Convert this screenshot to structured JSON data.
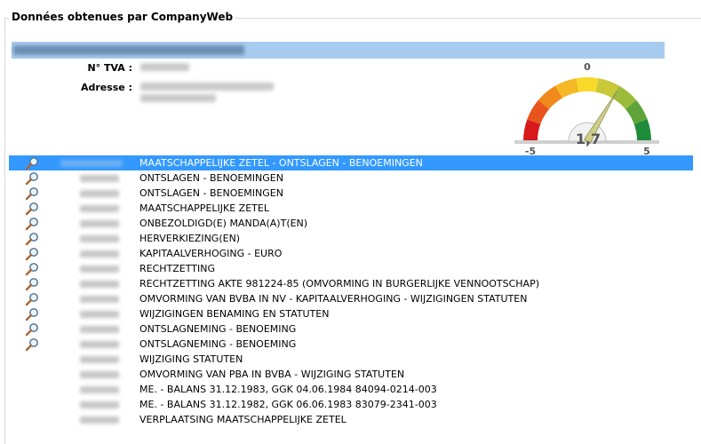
{
  "legend": "Données obtenues par CompanyWeb",
  "info": {
    "tva_label": "N° TVA :",
    "address_label": "Adresse :"
  },
  "gauge": {
    "value": "1,7",
    "value_numeric": 1.7,
    "min_label": "-5",
    "mid_label": "0",
    "max_label": "5",
    "colors": [
      "#d7191c",
      "#e8541b",
      "#f08a1d",
      "#f6b724",
      "#f8d92a",
      "#c8c838",
      "#9dbb3a",
      "#5ea43a",
      "#1e8c3a"
    ]
  },
  "rows": [
    {
      "text": "MAATSCHAPPELIJKE ZETEL - ONTSLAGEN - BENOEMINGEN",
      "icon": true,
      "selected": true
    },
    {
      "text": "ONTSLAGEN - BENOEMINGEN",
      "icon": true
    },
    {
      "text": "ONTSLAGEN - BENOEMINGEN",
      "icon": true
    },
    {
      "text": "MAATSCHAPPELIJKE ZETEL",
      "icon": true
    },
    {
      "text": "ONBEZOLDIGD(E) MANDA(A)T(EN)",
      "icon": true
    },
    {
      "text": "HERVERKIEZING(EN)",
      "icon": true
    },
    {
      "text": "KAPITAALVERHOGING - EURO",
      "icon": true
    },
    {
      "text": "RECHTZETTING",
      "icon": true
    },
    {
      "text": "RECHTZETTING AKTE 981224-85 (OMVORMING IN BURGERLIJKE VENNOOTSCHAP)",
      "icon": true
    },
    {
      "text": "OMVORMING VAN BVBA IN NV - KAPITAALVERHOGING - WIJZIGINGEN STATUTEN",
      "icon": true
    },
    {
      "text": "WIJZIGINGEN BENAMING EN STATUTEN",
      "icon": true
    },
    {
      "text": "ONTSLAGNEMING - BENOEMING",
      "icon": true
    },
    {
      "text": "ONTSLAGNEMING - BENOEMING",
      "icon": true
    },
    {
      "text": "WIJZIGING STATUTEN",
      "icon": false
    },
    {
      "text": "OMVORMING VAN PBA IN BVBA - WIJZIGING STATUTEN",
      "icon": false
    },
    {
      "text": "ME. - BALANS 31.12.1983, GGK 04.06.1984 84094-0214-003",
      "icon": false
    },
    {
      "text": "ME. - BALANS 31.12.1982, GGK 06.06.1983 83079-2341-003",
      "icon": false
    },
    {
      "text": "VERPLAATSING MAATSCHAPPELIJKE ZETEL",
      "icon": false
    }
  ]
}
